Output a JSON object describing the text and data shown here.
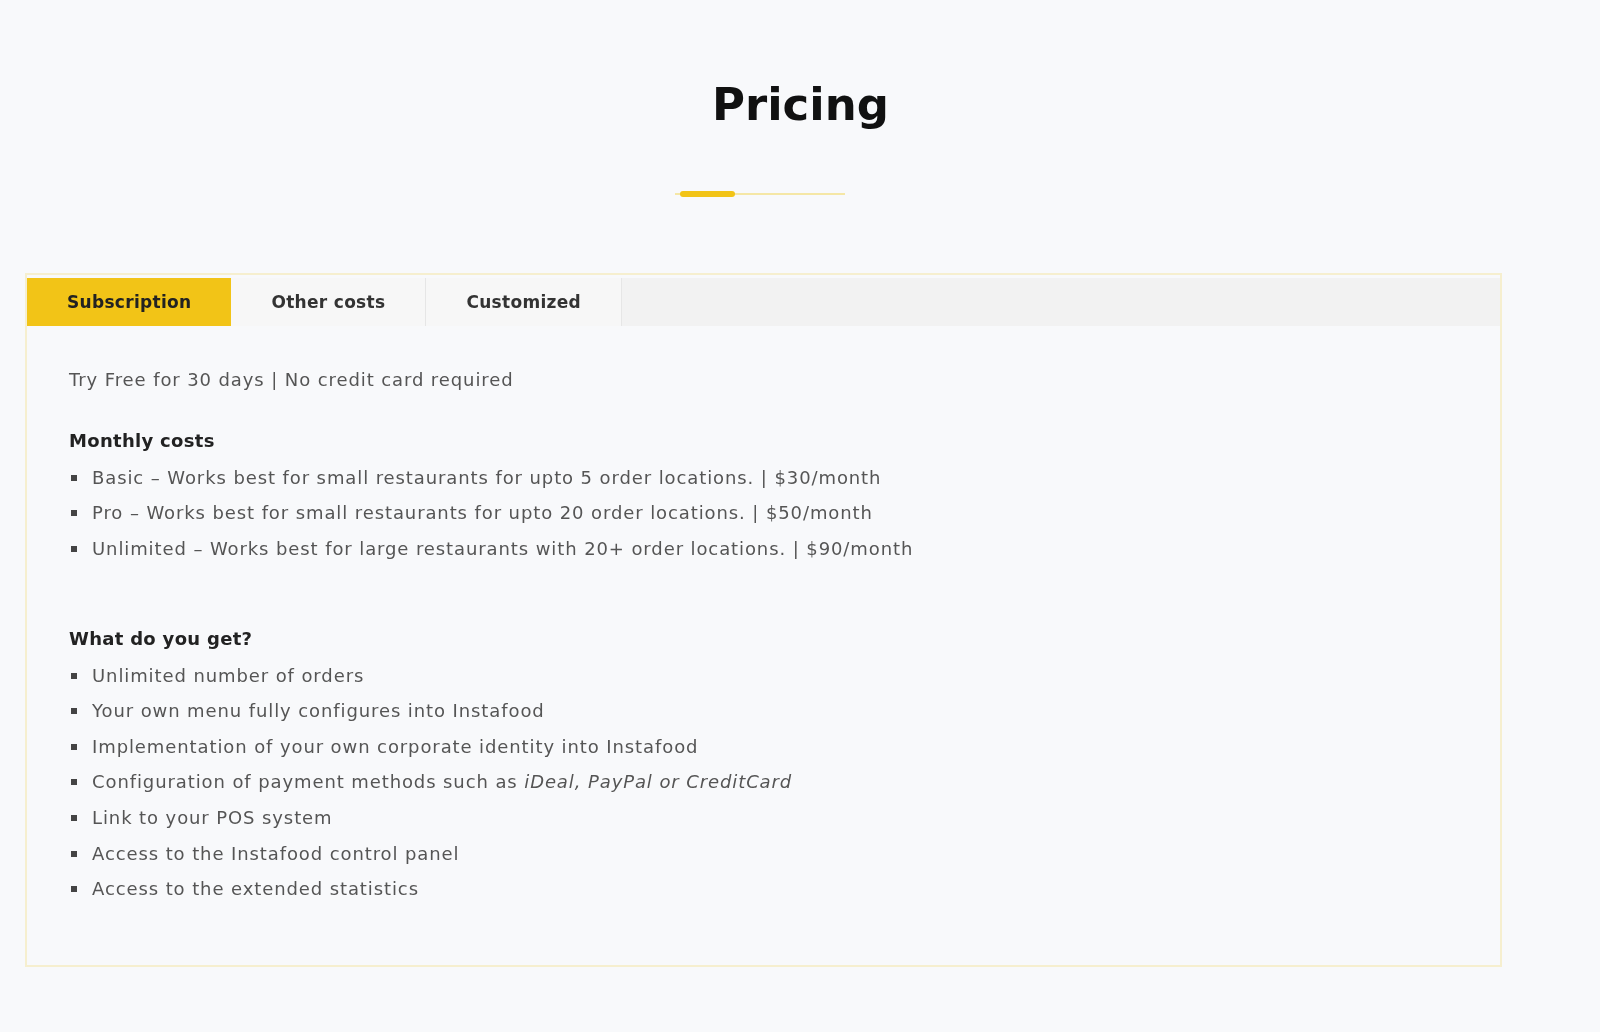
{
  "title": "Pricing",
  "tabs": [
    {
      "label": "Subscription",
      "selected": true
    },
    {
      "label": "Other costs",
      "selected": false
    },
    {
      "label": "Customized",
      "selected": false
    }
  ],
  "panel": {
    "intro": "Try Free for 30 days | No credit card required",
    "sections": [
      {
        "heading": "Monthly costs",
        "items": [
          "Basic – Works best for small restaurants for upto 5 order locations. | $30/month",
          "Pro – Works best for small restaurants for upto 20 order locations. | $50/month",
          "Unlimited – Works best for large restaurants with 20+ order locations. | $90/month"
        ]
      },
      {
        "heading": "What do you get?",
        "items": [
          "Unlimited number of orders",
          "Your own menu fully configures into Instafood",
          "Implementation of your own corporate identity into Instafood",
          "Configuration of payment methods such as *iDeal, PayPal or CreditCard*",
          "Link to your POS system",
          "Access to the Instafood control panel",
          "Access to the extended statistics"
        ]
      }
    ]
  }
}
